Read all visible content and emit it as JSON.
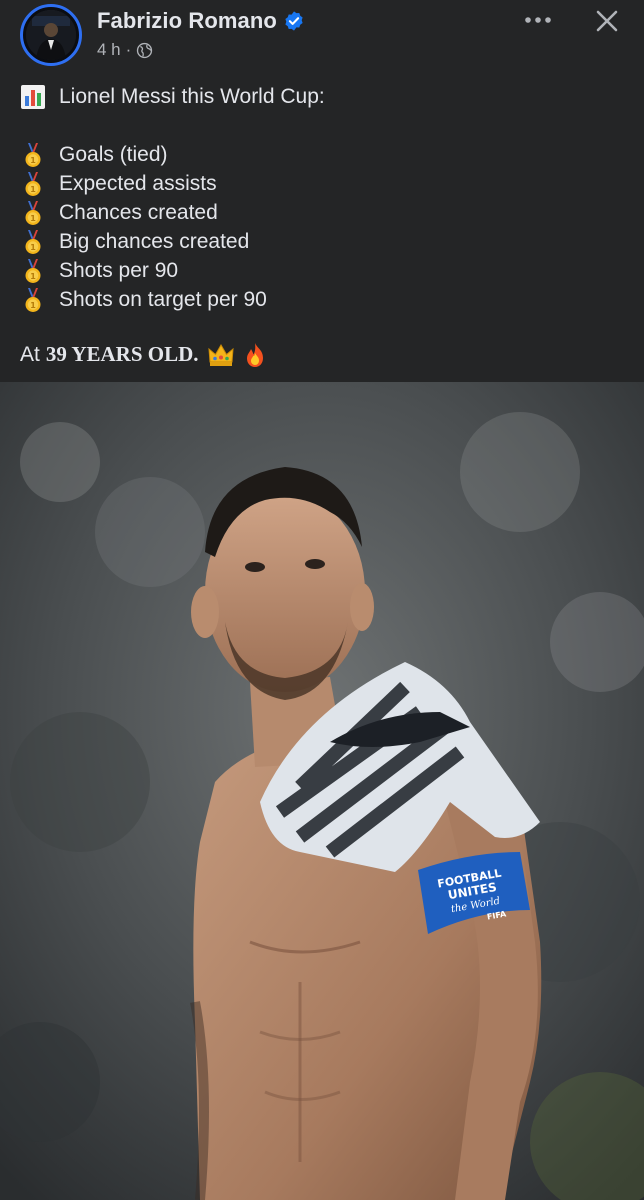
{
  "post": {
    "author_name": "Fabrizio Romano",
    "time": "4 h",
    "separator": "·",
    "headline": "Lionel Messi this World Cup:",
    "stats": [
      "Goals (tied)",
      "Expected assists",
      "Chances created",
      "Big chances created",
      "Shots per 90",
      "Shots on target per 90"
    ],
    "closing_prefix": "At",
    "closing_bold": "39 YEARS OLD.",
    "photo_armband_lines": [
      "FOOTBALL",
      "UNITES",
      "the World",
      "FIFA"
    ]
  },
  "icons": {
    "verified": "verified-badge-icon",
    "audience": "globe-icon",
    "headline": "bar-chart-icon",
    "stat_bullet": "gold-medal-icon",
    "closing": [
      "crown-icon",
      "fire-icon"
    ]
  },
  "colors": {
    "background": "#242526",
    "text": "#e4e6eb",
    "secondary_text": "#b0b3b8",
    "verified_blue": "#1877f2",
    "avatar_ring": "#2e6ff2",
    "armband_blue": "#1f5fbf"
  }
}
